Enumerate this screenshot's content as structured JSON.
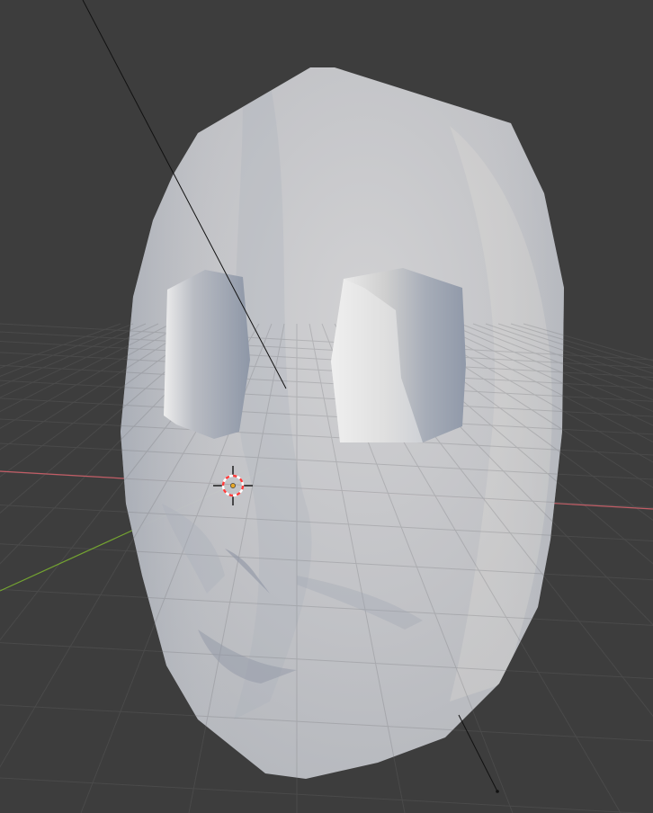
{
  "viewport": {
    "background_color": "#3d3d3d",
    "grid_color": "#4a4a4a",
    "x_axis_color": "#c25d66",
    "y_axis_color": "#74a431",
    "mesh_color": "#c6c7cb",
    "mesh_shadow_color": "#8f97a6",
    "mesh_highlight_color": "#e4e1da",
    "light_line_color": "#111111",
    "cursor_colors": [
      "#ff3b3b",
      "#ffffff",
      "#e6a72a"
    ]
  },
  "scene": {
    "object_type": "mesh",
    "shading_mode": "solid-xray",
    "icons": [
      "3d-cursor-icon",
      "light-direction-icon"
    ]
  }
}
